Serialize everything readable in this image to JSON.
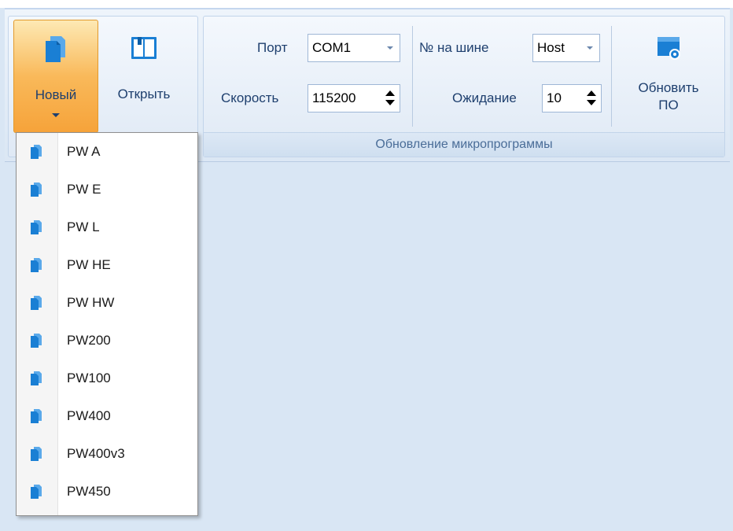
{
  "ribbon": {
    "file_group": {
      "new_label": "Новый",
      "open_label": "Открыть"
    },
    "firmware_group": {
      "caption": "Обновление микропрограммы",
      "port_label": "Порт",
      "port_value": "COM1",
      "speed_label": "Скорость",
      "speed_value": "115200",
      "bus_label": "№ на шине",
      "bus_value": "Host",
      "wait_label": "Ожидание",
      "wait_value": "10",
      "update_label_line1": "Обновить",
      "update_label_line2": "ПО"
    }
  },
  "new_menu": {
    "items": [
      "PW A",
      "PW E",
      "PW L",
      "PW HE",
      "PW HW",
      "PW200",
      "PW100",
      "PW400",
      "PW400v3",
      "PW450"
    ]
  },
  "colors": {
    "accent_active": "#f9b95a",
    "ribbon_text": "#1e3f6e",
    "caption_text": "#4a6d98",
    "icon_blue": "#1a7fd4"
  },
  "icons": {
    "new": "new-document-icon",
    "open": "open-book-icon",
    "update": "firmware-disk-icon",
    "menu_item": "document-icon"
  }
}
